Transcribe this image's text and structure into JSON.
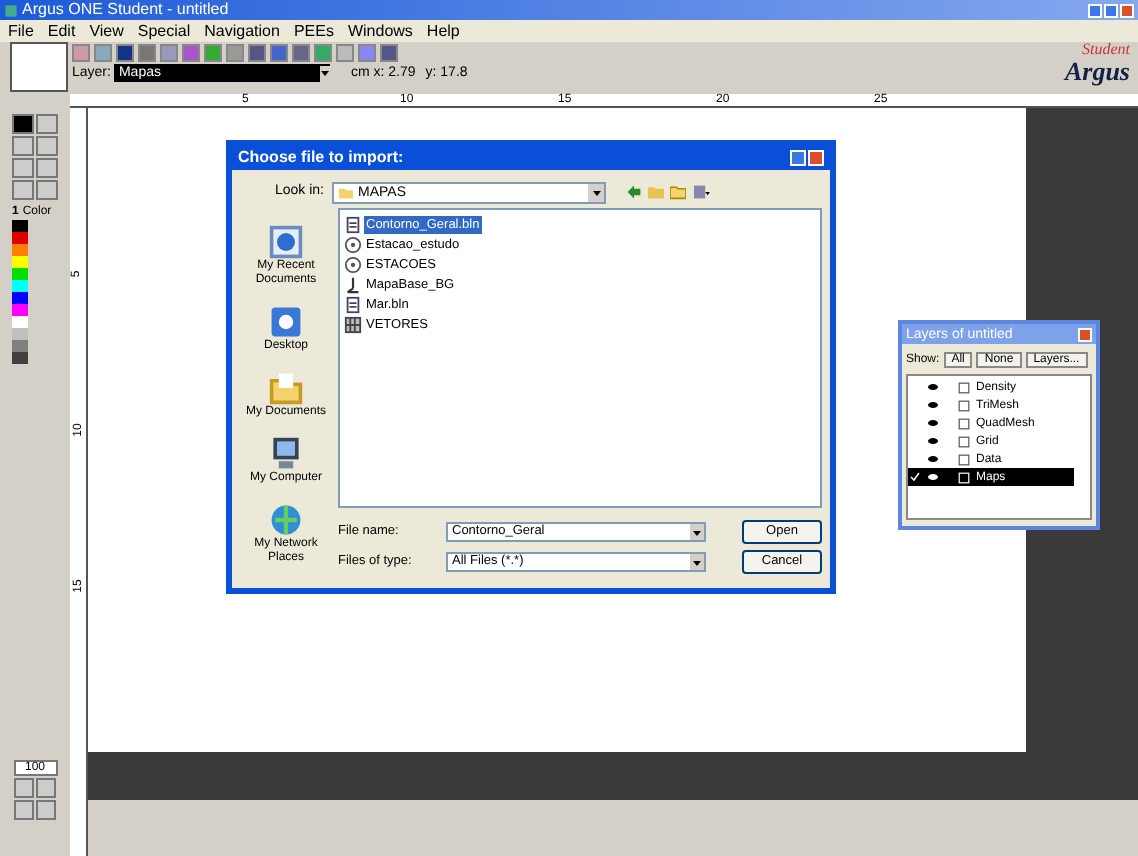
{
  "window": {
    "title": "Argus ONE Student - untitled"
  },
  "menu": [
    "File",
    "Edit",
    "View",
    "Special",
    "Navigation",
    "PEEs",
    "Windows",
    "Help"
  ],
  "toolbar": {
    "layer_label": "Layer:",
    "layer_value": "Mapas",
    "coord_x": "cm x: 2.79",
    "coord_y": "y: 17.8"
  },
  "logo": {
    "top": "Student",
    "bottom": "Argus"
  },
  "ruler": {
    "horizontal": [
      "5",
      "10",
      "15",
      "20",
      "25"
    ],
    "vertical": [
      "5",
      "10",
      "15"
    ]
  },
  "toolbox": {
    "color_index": "1",
    "color_label": "Color",
    "zoom": "100",
    "swatches": [
      {
        "color": "#000000"
      },
      {
        "color": "#e00000"
      },
      {
        "color": "#ff8000"
      },
      {
        "color": "#ffff00"
      },
      {
        "color": "#00e000"
      },
      {
        "color": "#00ffff"
      },
      {
        "color": "#0000ff"
      },
      {
        "color": "#ff00ff"
      },
      {
        "color": "#ffffff"
      },
      {
        "color": "#c0c0c0"
      },
      {
        "color": "#808080"
      },
      {
        "color": "#404040"
      }
    ]
  },
  "dialog": {
    "title": "Choose file to import:",
    "look_in_label": "Look in:",
    "look_in_value": "MAPAS",
    "places": [
      {
        "label": "My Recent Documents",
        "kind": "recent"
      },
      {
        "label": "Desktop",
        "kind": "desktop"
      },
      {
        "label": "My Documents",
        "kind": "documents"
      },
      {
        "label": "My Computer",
        "kind": "computer"
      },
      {
        "label": "My Network Places",
        "kind": "network"
      }
    ],
    "files": [
      {
        "name": "Contorno_Geral.bln",
        "kind": "doc",
        "selected": true
      },
      {
        "name": "Estacao_estudo",
        "kind": "round",
        "selected": false
      },
      {
        "name": "ESTACOES",
        "kind": "round",
        "selected": false
      },
      {
        "name": "MapaBase_BG",
        "kind": "map",
        "selected": false
      },
      {
        "name": "Mar.bln",
        "kind": "doc",
        "selected": false
      },
      {
        "name": "VETORES",
        "kind": "grid",
        "selected": false
      }
    ],
    "file_name_label": "File name:",
    "file_name_value": "Contorno_Geral",
    "file_type_label": "Files of type:",
    "file_type_value": "All Files (*.*)",
    "buttons": [
      "Open",
      "Cancel"
    ]
  },
  "layers": {
    "title": "Layers of untitled",
    "show_label": "Show:",
    "buttons": [
      "All",
      "None",
      "Layers..."
    ],
    "items": [
      {
        "name": "Density",
        "visible": true,
        "selected": false
      },
      {
        "name": "TriMesh",
        "visible": true,
        "selected": false
      },
      {
        "name": "QuadMesh",
        "visible": true,
        "selected": false
      },
      {
        "name": "Grid",
        "visible": true,
        "selected": false
      },
      {
        "name": "Data",
        "visible": true,
        "selected": false
      },
      {
        "name": "Maps",
        "visible": true,
        "selected": true
      }
    ]
  }
}
